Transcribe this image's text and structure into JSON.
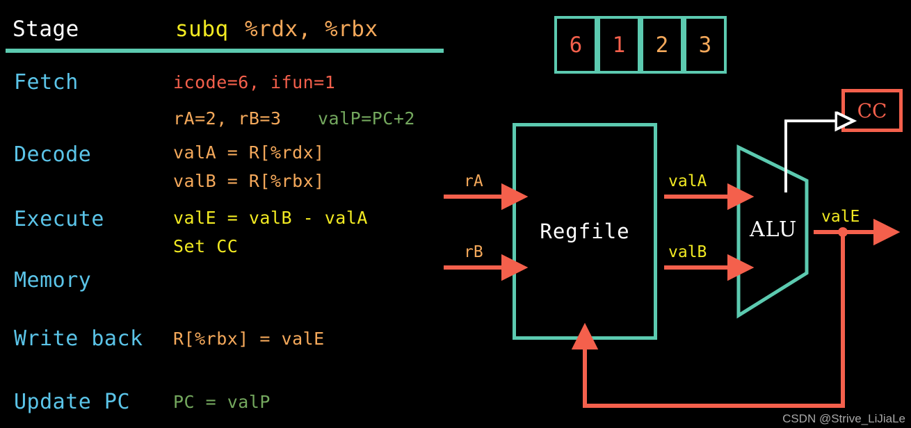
{
  "palette": {
    "background": "#000000",
    "teal": "#5ccab0",
    "salmon": "#f4604c",
    "yellow": "#f2ea22",
    "orange": "#f5a95b",
    "green": "#74a85e",
    "blue": "#5bc4e8",
    "white": "#ffffff"
  },
  "table": {
    "header": {
      "stage_column": "Stage",
      "instruction_mnemonic": "subq",
      "instruction_operands": "%rdx, %rbx"
    },
    "rows": [
      {
        "stage": "Fetch",
        "lines": [
          {
            "text": "icode=6, ifun=1",
            "color": "salmon"
          },
          {
            "text": "rA=2, rB=3",
            "color": "orange"
          },
          {
            "text": "valP=PC+2",
            "color": "green"
          }
        ]
      },
      {
        "stage": "Decode",
        "lines": [
          {
            "text": "valA = R[%rdx]",
            "color": "orange"
          },
          {
            "text": "valB = R[%rbx]",
            "color": "orange"
          }
        ]
      },
      {
        "stage": "Execute",
        "lines": [
          {
            "text": "valE = valB - valA",
            "color": "yellow"
          },
          {
            "text": "Set CC",
            "color": "yellow"
          }
        ]
      },
      {
        "stage": "Memory",
        "lines": []
      },
      {
        "stage": "Write back",
        "lines": [
          {
            "text": "R[%rbx] = valE",
            "color": "orange"
          }
        ]
      },
      {
        "stage": "Update PC",
        "lines": [
          {
            "text": "PC = valP",
            "color": "green"
          }
        ]
      }
    ]
  },
  "diagram": {
    "instruction_bytes": [
      {
        "value": "6",
        "color": "salmon"
      },
      {
        "value": "1",
        "color": "salmon"
      },
      {
        "value": "2",
        "color": "orange"
      },
      {
        "value": "3",
        "color": "orange"
      }
    ],
    "blocks": {
      "regfile_label": "Regfile",
      "alu_label": "ALU",
      "cc_label": "CC"
    },
    "wires": [
      {
        "name": "rA",
        "label": "rA",
        "color": "orange"
      },
      {
        "name": "rB",
        "label": "rB",
        "color": "orange"
      },
      {
        "name": "valA",
        "label": "valA",
        "color": "yellow"
      },
      {
        "name": "valB",
        "label": "valB",
        "color": "yellow"
      },
      {
        "name": "valE",
        "label": "valE",
        "color": "yellow"
      }
    ]
  },
  "watermark": "CSDN @Strive_LiJiaLe"
}
